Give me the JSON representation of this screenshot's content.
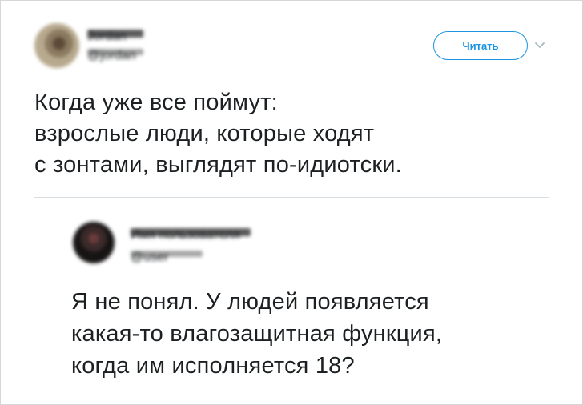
{
  "tweet": {
    "author_name": "Jordan",
    "author_handle": "@jordan",
    "follow_label": "Читать",
    "text": [
      "Когда уже все поймут:",
      "взрослые люди, которые ходят",
      "с зонтами, выглядят по-идиотски."
    ]
  },
  "quoted_reply": {
    "author_name": "Имя пользователя",
    "author_handle": "@user",
    "text": [
      "Я не понял. У людей появляется",
      "какая-то влагозащитная функция,",
      "когда им исполняется 18?"
    ]
  },
  "colors": {
    "accent": "#1b95e0",
    "text": "#1c2022",
    "muted": "#a7a7a7",
    "divider": "#d8dde1"
  },
  "icons": {
    "menu": "chevron-down-icon"
  }
}
